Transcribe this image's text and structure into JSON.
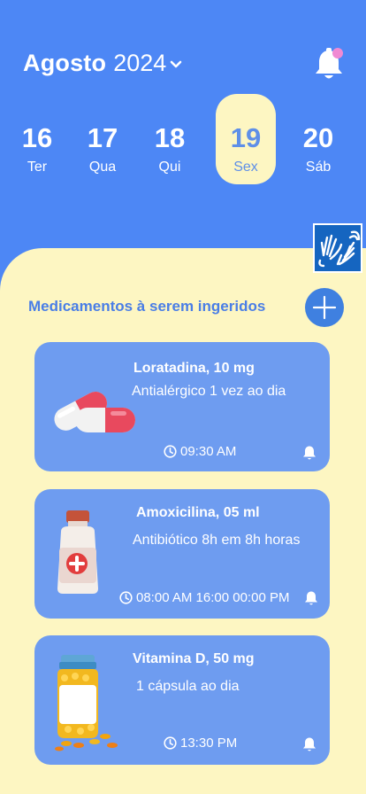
{
  "header": {
    "month": "Agosto",
    "year": "2024"
  },
  "days": [
    {
      "num": "16",
      "dow": "Ter",
      "selected": false
    },
    {
      "num": "17",
      "dow": "Qua",
      "selected": false
    },
    {
      "num": "18",
      "dow": "Qui",
      "selected": false
    },
    {
      "num": "19",
      "dow": "Sex",
      "selected": true
    },
    {
      "num": "20",
      "dow": "Sáb",
      "selected": false
    }
  ],
  "section": {
    "title": "Medicamentos à serem ingeridos"
  },
  "medications": [
    {
      "name": "Loratadina, 10 mg",
      "description": "Antialérgico 1 vez ao dia",
      "times": "09:30 AM",
      "illustration": "capsule-pills"
    },
    {
      "name": "Amoxicilina, 05 ml",
      "description": "Antibiótico 8h em 8h horas",
      "times": "08:00 AM 16:00 00:00 PM",
      "illustration": "medicine-bottle"
    },
    {
      "name": "Vitamina D, 50 mg",
      "description": "1 cápsula ao dia",
      "times": "13:30 PM",
      "illustration": "vitamin-jar"
    }
  ],
  "colors": {
    "header_bg": "#4d87f5",
    "panel_bg": "#fdf6c2",
    "card_bg": "#6e9cf0",
    "accent_text": "#4a7ee6",
    "notification_dot": "#f08ad3"
  },
  "icons": {
    "notification": "bell-icon",
    "accessibility": "sign-language-icon",
    "add": "plus-icon",
    "time": "clock-icon",
    "reminder": "bell-icon"
  }
}
